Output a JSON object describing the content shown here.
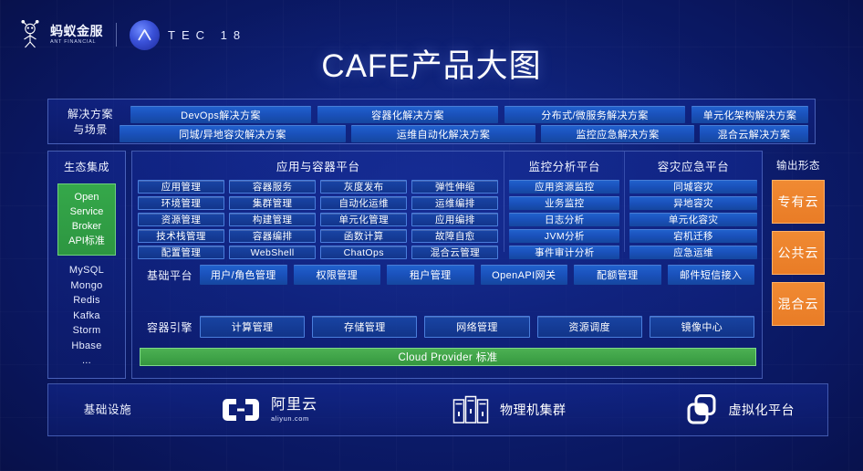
{
  "header": {
    "ant_logo_cn": "蚂蚁金服",
    "ant_logo_en": "ANT FINANCIAL",
    "atec_letters": "TEC 18"
  },
  "title": "CAFE产品大图",
  "solutions": {
    "label": "解决方案\n与场景",
    "row1": [
      "DevOps解决方案",
      "容器化解决方案",
      "分布式/微服务解决方案",
      "单元化架构解决方案"
    ],
    "row2": [
      "同城/异地容灾解决方案",
      "运维自动化解决方案",
      "监控应急解决方案",
      "混合云解决方案"
    ]
  },
  "ecosystem": {
    "label": "生态集成",
    "osb": [
      "Open",
      "Service",
      "Broker",
      "API标准"
    ],
    "items": [
      "MySQL",
      "Mongo",
      "Redis",
      "Kafka",
      "Storm",
      "Hbase",
      "..."
    ]
  },
  "app_platform": {
    "title": "应用与容器平台",
    "chips": [
      "应用管理",
      "容器服务",
      "灰度发布",
      "弹性伸缩",
      "环境管理",
      "集群管理",
      "自动化运维",
      "运维编排",
      "资源管理",
      "构建管理",
      "单元化管理",
      "应用编排",
      "技术栈管理",
      "容器编排",
      "函数计算",
      "故障自愈",
      "配置管理",
      "WebShell",
      "ChatOps",
      "混合云管理"
    ]
  },
  "monitor_platform": {
    "title": "监控分析平台",
    "chips": [
      "应用资源监控",
      "业务监控",
      "日志分析",
      "JVM分析",
      "事件审计分析"
    ]
  },
  "dr_platform": {
    "title": "容灾应急平台",
    "chips": [
      "同城容灾",
      "异地容灾",
      "单元化容灾",
      "宕机迁移",
      "应急运维"
    ]
  },
  "base_platform": {
    "label": "基础平台",
    "chips": [
      "用户/角色管理",
      "权限管理",
      "租户管理",
      "OpenAPI网关",
      "配额管理",
      "邮件短信接入"
    ]
  },
  "container_engine": {
    "label": "容器引擎",
    "chips": [
      "计算管理",
      "存储管理",
      "网络管理",
      "资源调度",
      "镜像中心"
    ]
  },
  "cloud_provider": {
    "label": "Cloud Provider 标准"
  },
  "output": {
    "label": "输出形态",
    "boxes": [
      "专有云",
      "公共云",
      "混合云"
    ]
  },
  "infrastructure": {
    "label": "基础设施",
    "items": [
      {
        "name": "阿里云",
        "sub": "aliyun.com",
        "icon": "aliyun-logo-icon"
      },
      {
        "name": "物理机集群",
        "sub": "",
        "icon": "server-rack-icon"
      },
      {
        "name": "虚拟化平台",
        "sub": "",
        "icon": "vmware-squares-icon"
      }
    ]
  },
  "colors": {
    "background": "#0a1252",
    "chip_blue": "#1a51bb",
    "accent_green": "#35a84a",
    "accent_orange": "#ee8029"
  }
}
